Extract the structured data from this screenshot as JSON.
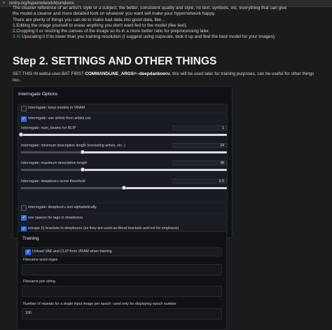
{
  "browser": {
    "url": "rentry.org/hypernetwork4dumdums"
  },
  "intro": {
    "line1": "The cleaner reference of an artist's style or a subject, the better, consistent quality and style, no text, symbols, etc, everything that can give",
    "line2": "the model a cleaner and more detailed look on whatever you want will make your hypernetwork happy.",
    "line3": "There are plenty of things you can do to make bad data into good data, like...",
    "line4": "1.Editing the image yourself to erase anything you don't want fed to the model (like text).",
    "line5": "2.Cropping it or resizing the canvas of the image so its in a more better ratio for preprocessing later.",
    "line6_link": "3.AI",
    "line6_rest": " Upscaling it if its lower than you training resolution (I suggest using cupscale, look it up and find the best model for your images)."
  },
  "section_heading": "Step 2. SETTINGS AND OTHER THINGS",
  "settings_note": {
    "prefix": "SET THIS IN webui-user.BAT FIRST ",
    "bold": "COMMANDLINE_ARGS=--deepdanbooru",
    "suffix": ", this will be used later for training purposes, can be useful for other things too.."
  },
  "interrogate": {
    "title": "Interrogate Options",
    "keep_models": {
      "label": "Interrogate: keep models in VRAM",
      "checked": false
    },
    "use_artists": {
      "label": "Interrogate: use artists from artists.csv",
      "checked": true
    },
    "num_beams": {
      "label": "Interrogate: num_beams for BLIP",
      "value": "1",
      "fraction": 0.0
    },
    "min_len": {
      "label": "Interrogate: minimum description length (excluding artists, etc..)",
      "value": "24",
      "fraction": 0.3
    },
    "max_len": {
      "label": "Interrogate: maximum description length",
      "value": "48",
      "fraction": 0.3
    },
    "score_threshold": {
      "label": "Interrogate: deepbooru score threshold",
      "value": "0.5",
      "fraction": 0.5
    },
    "sort_alpha": {
      "label": "Interrogate: deepbooru sort alphabetically",
      "checked": false
    },
    "use_spaces": {
      "label": "use spaces for tags in deepbooru",
      "checked": true
    },
    "escape_brackets": {
      "label": "escape (\\) brackets in deepbooru (so they are used as literal brackets and not for emphasis)",
      "checked": true
    }
  },
  "training": {
    "title": "Training",
    "unload_vae": {
      "label": "Unload VAE and CLIP from VRAM when training",
      "checked": true
    },
    "filename_word_regex": {
      "label": "Filename word regex",
      "value": ""
    },
    "filename_join_string": {
      "label": "Filename join string",
      "value": ""
    },
    "repeats": {
      "label": "Number of repeats for a single input image per epoch; used only for displaying epoch number",
      "value": "100"
    }
  },
  "colors": {
    "accent": "#2f6fed",
    "link": "#5b9bd5",
    "background": "#1b1b1b",
    "panel": "#0f1115"
  }
}
